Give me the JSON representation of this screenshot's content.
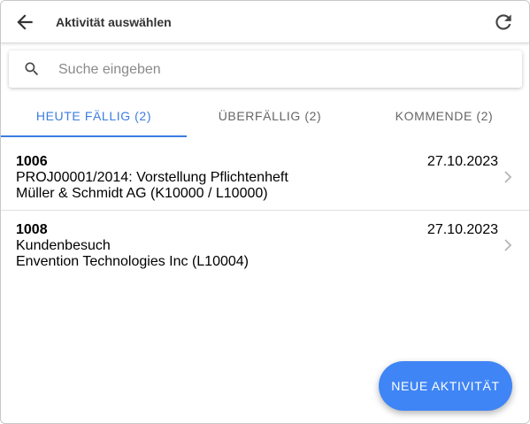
{
  "header": {
    "title": "Aktivität auswählen",
    "back_icon": "arrow-left-icon",
    "refresh_icon": "refresh-icon"
  },
  "search": {
    "placeholder": "Suche eingeben",
    "value": "",
    "icon": "search-icon"
  },
  "tabs": [
    {
      "label": "HEUTE FÄLLIG (2)",
      "active": true
    },
    {
      "label": "ÜBERFÄLLIG (2)",
      "active": false
    },
    {
      "label": "KOMMENDE (2)",
      "active": false
    }
  ],
  "activities": [
    {
      "id": "1006",
      "subject": "PROJ00001/2014: Vorstellung Pflichtenheft",
      "customer": "Müller & Schmidt AG (K10000 / L10000)",
      "date": "27.10.2023"
    },
    {
      "id": "1008",
      "subject": "Kundenbesuch",
      "customer": "Envention Technologies Inc (L10004)",
      "date": "27.10.2023"
    }
  ],
  "fab": {
    "label": "NEUE AKTIVITÄT"
  },
  "colors": {
    "accent": "#3b7de0",
    "fab": "#3f85f5"
  }
}
